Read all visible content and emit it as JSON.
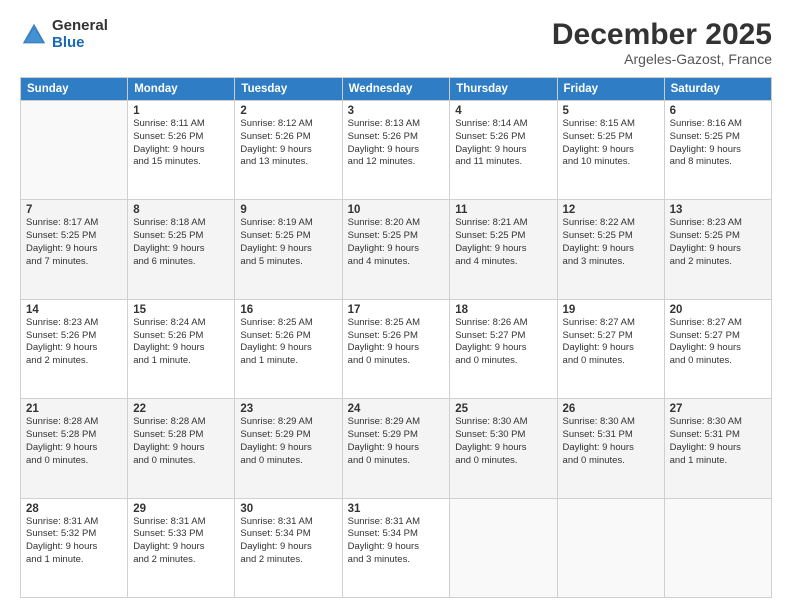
{
  "header": {
    "logo_general": "General",
    "logo_blue": "Blue",
    "title": "December 2025",
    "location": "Argeles-Gazost, France"
  },
  "columns": [
    "Sunday",
    "Monday",
    "Tuesday",
    "Wednesday",
    "Thursday",
    "Friday",
    "Saturday"
  ],
  "rows": [
    [
      {
        "date": "",
        "info": ""
      },
      {
        "date": "1",
        "info": "Sunrise: 8:11 AM\nSunset: 5:26 PM\nDaylight: 9 hours\nand 15 minutes."
      },
      {
        "date": "2",
        "info": "Sunrise: 8:12 AM\nSunset: 5:26 PM\nDaylight: 9 hours\nand 13 minutes."
      },
      {
        "date": "3",
        "info": "Sunrise: 8:13 AM\nSunset: 5:26 PM\nDaylight: 9 hours\nand 12 minutes."
      },
      {
        "date": "4",
        "info": "Sunrise: 8:14 AM\nSunset: 5:26 PM\nDaylight: 9 hours\nand 11 minutes."
      },
      {
        "date": "5",
        "info": "Sunrise: 8:15 AM\nSunset: 5:25 PM\nDaylight: 9 hours\nand 10 minutes."
      },
      {
        "date": "6",
        "info": "Sunrise: 8:16 AM\nSunset: 5:25 PM\nDaylight: 9 hours\nand 8 minutes."
      }
    ],
    [
      {
        "date": "7",
        "info": "Sunrise: 8:17 AM\nSunset: 5:25 PM\nDaylight: 9 hours\nand 7 minutes."
      },
      {
        "date": "8",
        "info": "Sunrise: 8:18 AM\nSunset: 5:25 PM\nDaylight: 9 hours\nand 6 minutes."
      },
      {
        "date": "9",
        "info": "Sunrise: 8:19 AM\nSunset: 5:25 PM\nDaylight: 9 hours\nand 5 minutes."
      },
      {
        "date": "10",
        "info": "Sunrise: 8:20 AM\nSunset: 5:25 PM\nDaylight: 9 hours\nand 4 minutes."
      },
      {
        "date": "11",
        "info": "Sunrise: 8:21 AM\nSunset: 5:25 PM\nDaylight: 9 hours\nand 4 minutes."
      },
      {
        "date": "12",
        "info": "Sunrise: 8:22 AM\nSunset: 5:25 PM\nDaylight: 9 hours\nand 3 minutes."
      },
      {
        "date": "13",
        "info": "Sunrise: 8:23 AM\nSunset: 5:25 PM\nDaylight: 9 hours\nand 2 minutes."
      }
    ],
    [
      {
        "date": "14",
        "info": "Sunrise: 8:23 AM\nSunset: 5:26 PM\nDaylight: 9 hours\nand 2 minutes."
      },
      {
        "date": "15",
        "info": "Sunrise: 8:24 AM\nSunset: 5:26 PM\nDaylight: 9 hours\nand 1 minute."
      },
      {
        "date": "16",
        "info": "Sunrise: 8:25 AM\nSunset: 5:26 PM\nDaylight: 9 hours\nand 1 minute."
      },
      {
        "date": "17",
        "info": "Sunrise: 8:25 AM\nSunset: 5:26 PM\nDaylight: 9 hours\nand 0 minutes."
      },
      {
        "date": "18",
        "info": "Sunrise: 8:26 AM\nSunset: 5:27 PM\nDaylight: 9 hours\nand 0 minutes."
      },
      {
        "date": "19",
        "info": "Sunrise: 8:27 AM\nSunset: 5:27 PM\nDaylight: 9 hours\nand 0 minutes."
      },
      {
        "date": "20",
        "info": "Sunrise: 8:27 AM\nSunset: 5:27 PM\nDaylight: 9 hours\nand 0 minutes."
      }
    ],
    [
      {
        "date": "21",
        "info": "Sunrise: 8:28 AM\nSunset: 5:28 PM\nDaylight: 9 hours\nand 0 minutes."
      },
      {
        "date": "22",
        "info": "Sunrise: 8:28 AM\nSunset: 5:28 PM\nDaylight: 9 hours\nand 0 minutes."
      },
      {
        "date": "23",
        "info": "Sunrise: 8:29 AM\nSunset: 5:29 PM\nDaylight: 9 hours\nand 0 minutes."
      },
      {
        "date": "24",
        "info": "Sunrise: 8:29 AM\nSunset: 5:29 PM\nDaylight: 9 hours\nand 0 minutes."
      },
      {
        "date": "25",
        "info": "Sunrise: 8:30 AM\nSunset: 5:30 PM\nDaylight: 9 hours\nand 0 minutes."
      },
      {
        "date": "26",
        "info": "Sunrise: 8:30 AM\nSunset: 5:31 PM\nDaylight: 9 hours\nand 0 minutes."
      },
      {
        "date": "27",
        "info": "Sunrise: 8:30 AM\nSunset: 5:31 PM\nDaylight: 9 hours\nand 1 minute."
      }
    ],
    [
      {
        "date": "28",
        "info": "Sunrise: 8:31 AM\nSunset: 5:32 PM\nDaylight: 9 hours\nand 1 minute."
      },
      {
        "date": "29",
        "info": "Sunrise: 8:31 AM\nSunset: 5:33 PM\nDaylight: 9 hours\nand 2 minutes."
      },
      {
        "date": "30",
        "info": "Sunrise: 8:31 AM\nSunset: 5:34 PM\nDaylight: 9 hours\nand 2 minutes."
      },
      {
        "date": "31",
        "info": "Sunrise: 8:31 AM\nSunset: 5:34 PM\nDaylight: 9 hours\nand 3 minutes."
      },
      {
        "date": "",
        "info": ""
      },
      {
        "date": "",
        "info": ""
      },
      {
        "date": "",
        "info": ""
      }
    ]
  ]
}
